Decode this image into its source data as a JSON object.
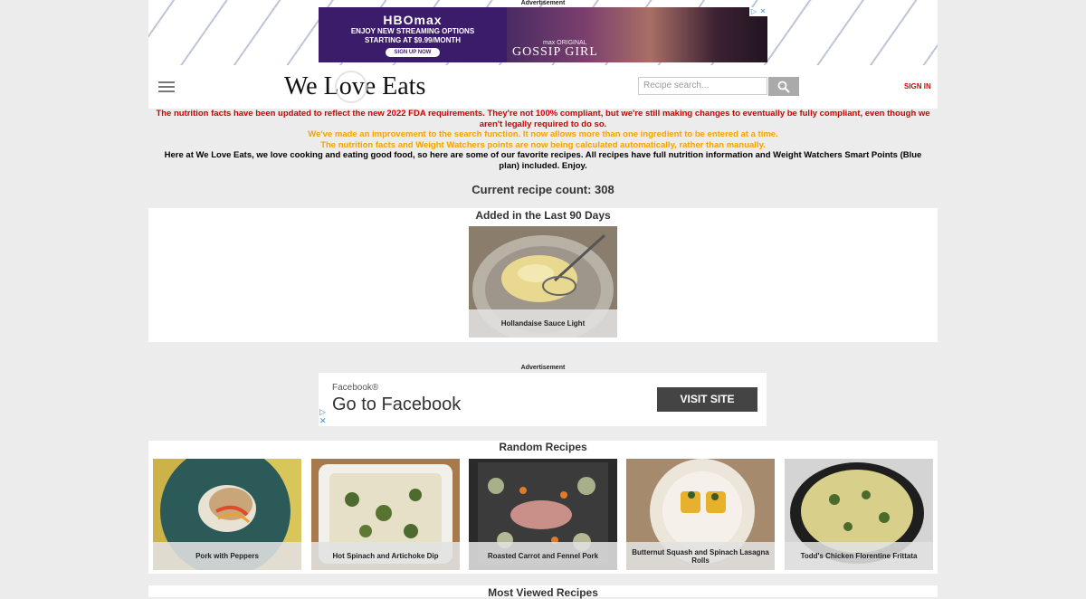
{
  "top_ad": {
    "label": "Advertisement",
    "brand": "HBOmax",
    "line1": "ENJOY NEW STREAMING OPTIONS",
    "line2": "STARTING AT $9.99/MONTH",
    "cta": "SIGN UP NOW",
    "sub_brand": "max ORIGINAL",
    "show": "GOSSIP GIRL"
  },
  "header": {
    "logo": "We Love Eats",
    "search_placeholder": "Recipe search...",
    "search_icon": "search-icon",
    "signin": "SIGN IN"
  },
  "notices": {
    "red": "The nutrition facts have been updated to reflect the new 2022 FDA requirements. They're not 100% compliant, but we're still making changes to eventually be fully compliant, even though we aren't legally required to do so.",
    "orange1": "We've made an improvement to the search function. It now allows more than one ingredient to be entered at a time.",
    "orange2": "The nutrition facts and Weight Watchers points are now being calculated automatically, rather than manually.",
    "intro": "Here at We Love Eats, we love cooking and eating good food, so here are some of our favorite recipes. All recipes have full nutrition information and Weight Watchers Smart Points (Blue plan) included. Enjoy."
  },
  "recipe_count": "Current recipe count: 308",
  "recent": {
    "title": "Added in the Last 90 Days",
    "items": [
      {
        "name": "Hollandaise Sauce Light"
      }
    ]
  },
  "mid_ad": {
    "label": "Advertisement",
    "sponsor": "Facebook®",
    "title": "Go to Facebook",
    "button": "VISIT SITE"
  },
  "random": {
    "title": "Random Recipes",
    "items": [
      {
        "name": "Pork with Peppers"
      },
      {
        "name": "Hot Spinach and Artichoke Dip"
      },
      {
        "name": "Roasted Carrot and Fennel Pork"
      },
      {
        "name": "Butternut Squash and Spinach Lasagna Rolls"
      },
      {
        "name": "Todd's Chicken Florentine Frittata"
      }
    ]
  },
  "most_viewed": {
    "title": "Most Viewed Recipes"
  },
  "colors": {
    "notice_red": "#d40000",
    "notice_orange": "#f5a300",
    "signin": "#dd0000"
  }
}
